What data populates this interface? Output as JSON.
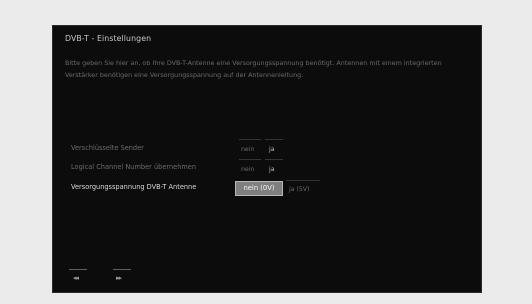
{
  "dialog": {
    "title": "DVB-T - Einstellungen",
    "description": "Bitte geben Sie hier an, ob Ihre DVB-T-Antenne eine Versorgungsspannung benötigt. Antennen mit einem integrierten Verstärker benötigen eine Versorgungsspannung auf der Antennenleitung."
  },
  "settings": [
    {
      "label": "Verschlüsselte Sender",
      "options": [
        "nein",
        "ja"
      ],
      "selected": "ja"
    },
    {
      "label": "Logical Channel Number übernehmen",
      "options": [
        "nein",
        "ja"
      ],
      "selected": "ja"
    },
    {
      "label": "Versorgungsspannung DVB-T Antenne",
      "options": [
        "nein (0V)",
        "ja (5V)"
      ],
      "selected": "nein (0V)"
    }
  ],
  "nav": {
    "back_icon": "rewind-icon",
    "forward_icon": "fast-forward-icon",
    "back_glyph": "◂◂",
    "forward_glyph": "▸▸"
  },
  "colors": {
    "background": "#0c0c0c",
    "highlight": "#7f7f7f"
  }
}
